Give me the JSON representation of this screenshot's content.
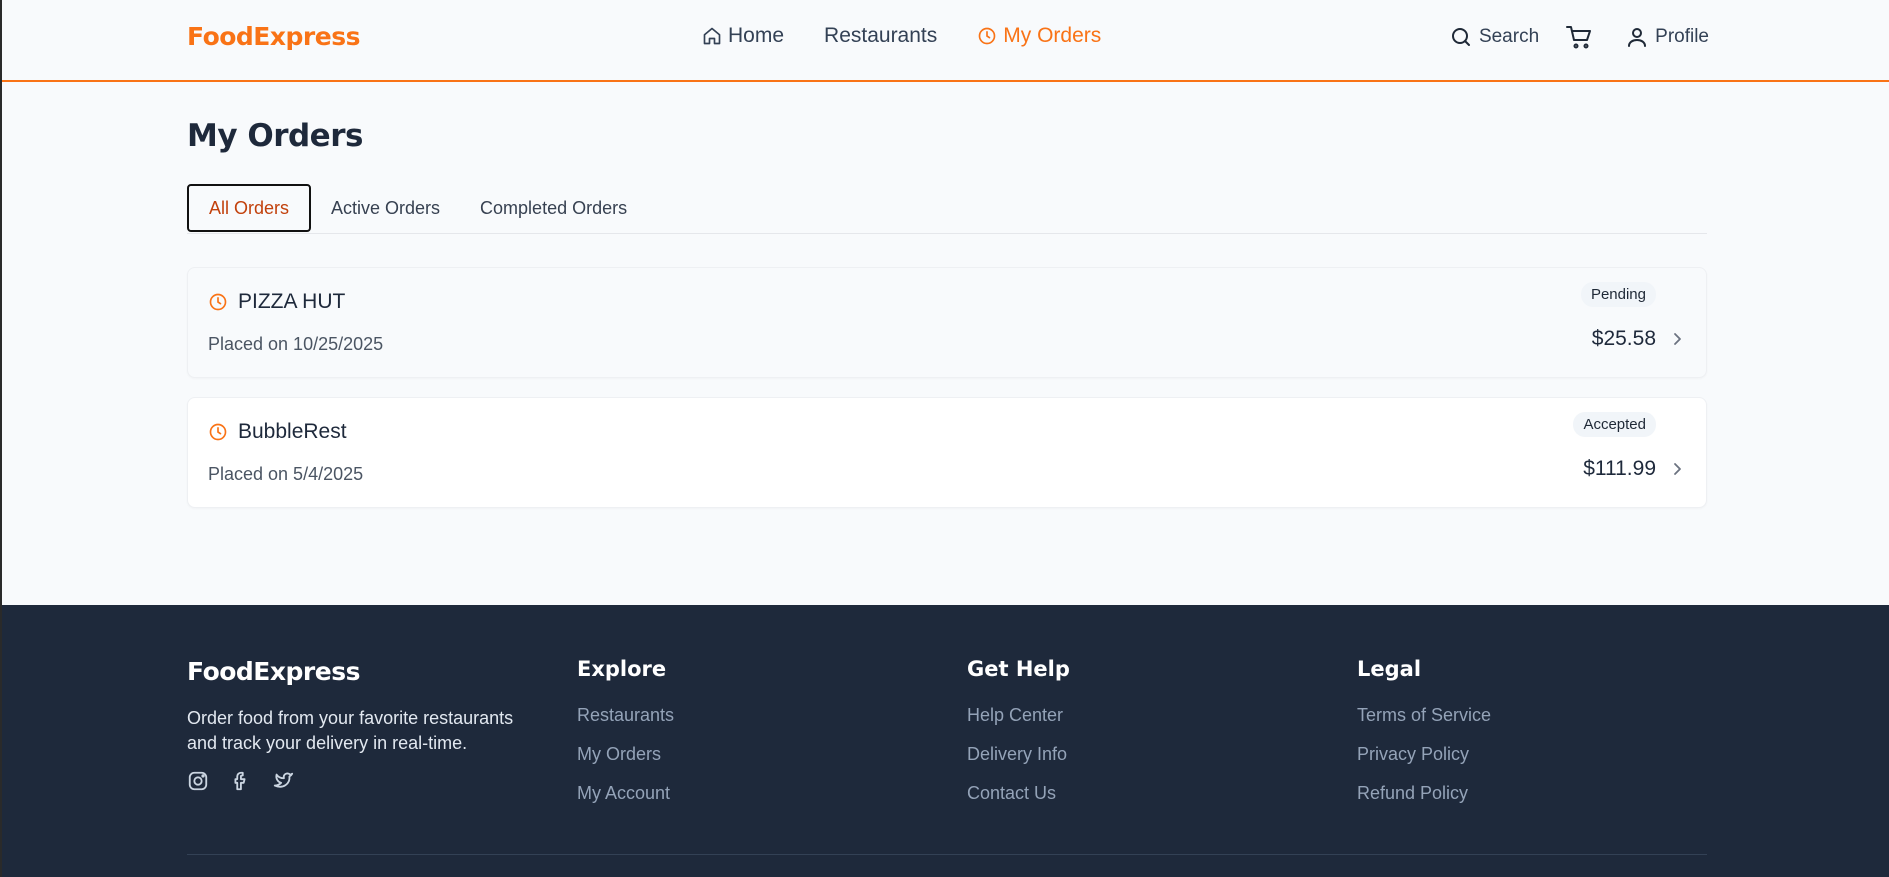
{
  "header": {
    "brand": "FoodExpress",
    "nav": [
      {
        "label": "Home",
        "icon": "home-icon"
      },
      {
        "label": "Restaurants"
      },
      {
        "label": "My Orders",
        "icon": "clock-icon",
        "active": true
      }
    ],
    "actions": {
      "search_label": "Search",
      "profile_label": "Profile"
    }
  },
  "main": {
    "title": "My Orders",
    "tabs": [
      {
        "label": "All Orders",
        "active": true
      },
      {
        "label": "Active Orders"
      },
      {
        "label": "Completed Orders"
      }
    ],
    "orders": [
      {
        "restaurant": "PIZZA HUT",
        "placed": "Placed on 10/25/2025",
        "status": "Pending",
        "total": "$25.58"
      },
      {
        "restaurant": "BubbleRest",
        "placed": "Placed on 5/4/2025",
        "status": "Accepted",
        "total": "$111.99"
      }
    ]
  },
  "footer": {
    "brand": "FoodExpress",
    "description": "Order food from your favorite restaurants and track your delivery in real-time.",
    "socials": [
      "instagram-icon",
      "facebook-icon",
      "twitter-icon"
    ],
    "columns": [
      {
        "heading": "Explore",
        "links": [
          "Restaurants",
          "My Orders",
          "My Account"
        ]
      },
      {
        "heading": "Get Help",
        "links": [
          "Help Center",
          "Delivery Info",
          "Contact Us"
        ]
      },
      {
        "heading": "Legal",
        "links": [
          "Terms of Service",
          "Privacy Policy",
          "Refund Policy"
        ]
      }
    ]
  },
  "colors": {
    "accent": "#f97316",
    "footer_bg": "#1e293b",
    "page_bg": "#f8fafc"
  }
}
